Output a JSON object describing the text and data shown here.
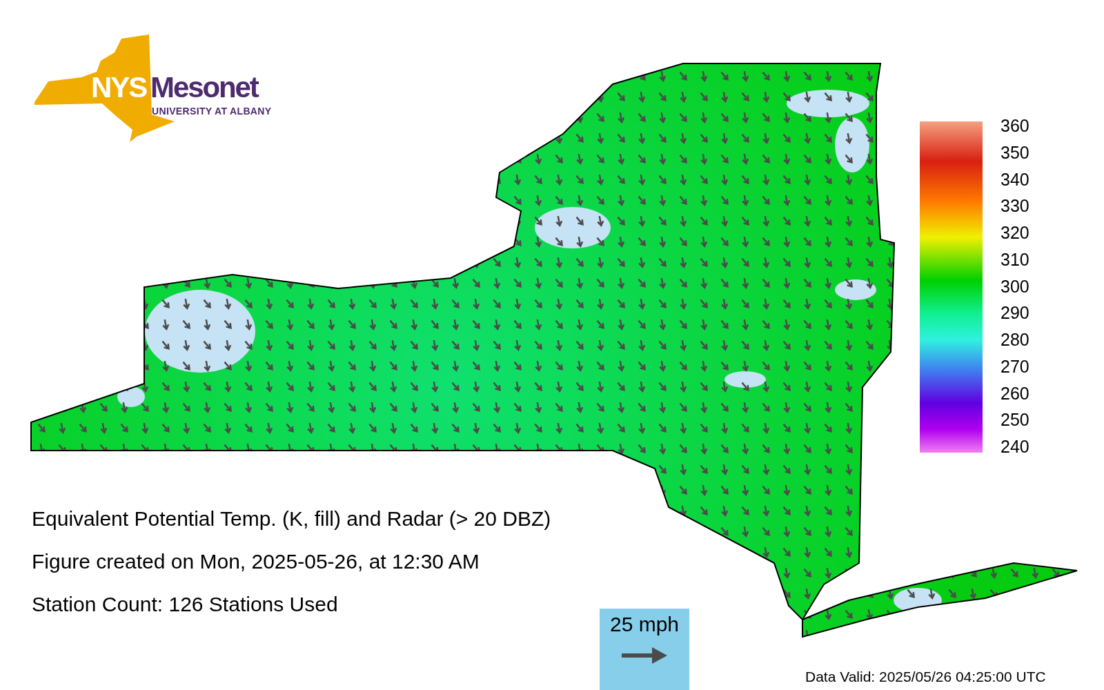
{
  "logo": {
    "abbr": "NYS",
    "name": "Mesonet",
    "subtitle": "UNIVERSITY AT ALBANY"
  },
  "colorbar": {
    "labels": [
      "360",
      "350",
      "340",
      "330",
      "320",
      "310",
      "300",
      "290",
      "280",
      "270",
      "260",
      "250",
      "240"
    ]
  },
  "captions": [
    "Equivalent Potential Temp. (K, fill) and Radar (> 20 DBZ)",
    "Figure created on Mon, 2025-05-26, at 12:30 AM",
    "Station Count: 126 Stations Used"
  ],
  "legend": {
    "label": "25 mph"
  },
  "data_valid": "Data Valid: 2025/05/26 04:25:00 UTC"
}
